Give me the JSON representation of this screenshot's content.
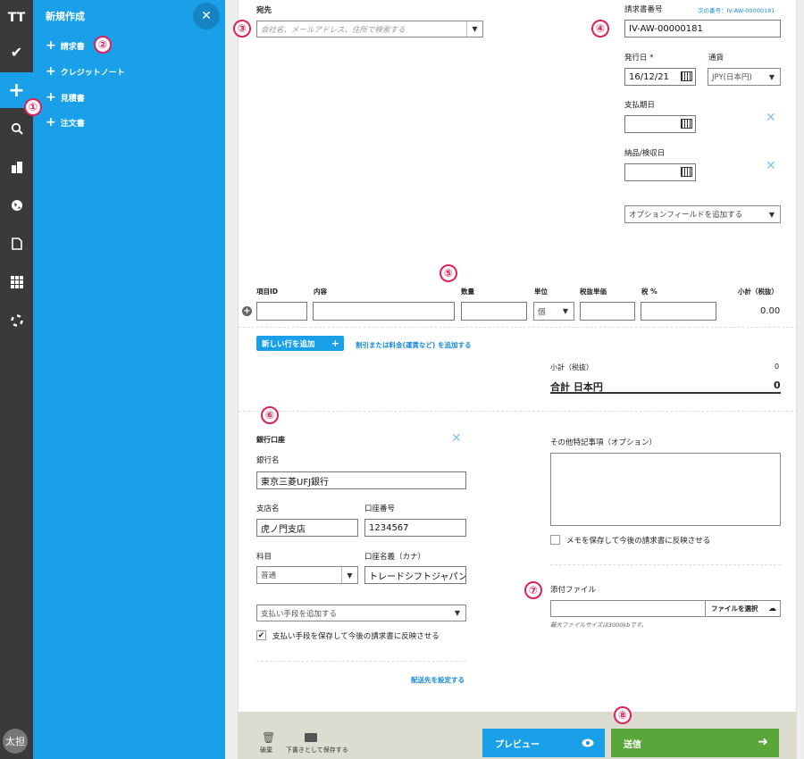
{
  "rail": {
    "logo": "TT",
    "avatar": "太担"
  },
  "menu": {
    "title": "新規作成",
    "close": "✕",
    "items": [
      {
        "label": "請求書"
      },
      {
        "label": "クレジットノート"
      },
      {
        "label": "見積書"
      },
      {
        "label": "注文書"
      }
    ]
  },
  "badges": [
    "①",
    "②",
    "③",
    "④",
    "⑤",
    "⑥",
    "⑦",
    "⑧"
  ],
  "recipient": {
    "label": "宛先",
    "placeholder": "会社名、メールアドレス、住所で検索する"
  },
  "invoice": {
    "number_label": "請求書番号",
    "next_number": "次の番号：IV-AW-00000181",
    "number": "IV-AW-00000181",
    "issue_date_label": "発行日 *",
    "issue_date": "16/12/21",
    "currency_label": "通貨",
    "currency": "JPY(日本円)",
    "due_date_label": "支払期日",
    "delivery_label": "納品/検収日",
    "option_field": "オプションフィールドを追加する"
  },
  "items": {
    "headers": {
      "id": "項目ID",
      "desc": "内容",
      "qty": "数量",
      "unit": "単位",
      "price": "税抜単価",
      "tax": "税 %",
      "subtotal": "小計（税抜）"
    },
    "unit_value": "個",
    "row_subtotal": "0.00",
    "add_row": "新しい行を追加",
    "add_discount": "割引または料金(運賃など) を追加する"
  },
  "totals": {
    "subtotal_label": "小計（税抜）",
    "subtotal_value": "0",
    "total_label": "合計 日本円",
    "total_value": "0"
  },
  "bank": {
    "title": "銀行口座",
    "bank_name_label": "銀行名",
    "bank_name": "東京三菱UFJ銀行",
    "branch_label": "支店名",
    "branch": "虎ノ門支店",
    "account_no_label": "口座番号",
    "account_no": "1234567",
    "type_label": "科目",
    "type": "普通",
    "holder_label": "口座名義（カナ）",
    "holder": "トレードシフトジャパン",
    "add_payment": "支払い手段を追加する",
    "save_payment": "支払い手段を保存して今後の請求書に反映させる",
    "ship_to": "配送先を設定する"
  },
  "notes": {
    "label": "その他特記事項（オプション）",
    "save_memo": "メモを保存して今後の請求書に反映させる"
  },
  "attachment": {
    "label": "添付ファイル",
    "choose": "ファイルを選択",
    "max_size": "最大ファイルサイズは3000kbです。"
  },
  "footer": {
    "discard": "破棄",
    "save_draft": "下書きとして保存する",
    "preview": "プレビュー",
    "send": "送信"
  },
  "colors": {
    "accent": "#1aa0e8",
    "send": "#5aa63a",
    "badge": "#e0205a",
    "rail": "#3a3a3a"
  }
}
